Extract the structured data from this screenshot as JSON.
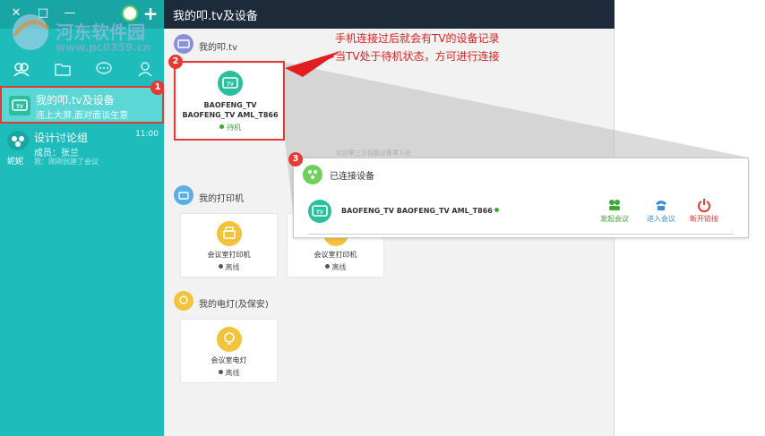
{
  "sidebar": {
    "items": [
      {
        "title": "我的叩.tv及设备",
        "subtitle": "连上大屏,面对面谈生意"
      },
      {
        "title": "设计讨论组",
        "subtitle": "成员：张兰",
        "extra": "我：刚刚创建了会议",
        "time": "11:00",
        "owner": "妮妮"
      }
    ],
    "badge": "1"
  },
  "main": {
    "title": "我的叩.tv及设备",
    "sections": {
      "tv": {
        "label": "我的叩.tv"
      },
      "printer": {
        "label": "我的打印机"
      },
      "light": {
        "label": "我的电灯(及保安)"
      }
    },
    "tv_card": {
      "name_line1": "BAOFENG_TV",
      "name_line2": "BAOFENG_TV AML_T866",
      "status": "待机"
    },
    "printer_cards": [
      {
        "name": "会议室打印机",
        "status": "离线"
      },
      {
        "name": "会议室打印机",
        "status": "离线"
      }
    ],
    "light_card": {
      "name": "会议室电灯",
      "status": "离线"
    },
    "welcome": "欢迎第三方智能设备乘入驻",
    "badge": "2"
  },
  "annotation": {
    "line1": "手机连接过后就会有TV的设备记录",
    "line2": "当TV处于待机状态，方可进行连接"
  },
  "popup": {
    "title": "已连接设备",
    "device": "BAOFENG_TV BAOFENG_TV AML_T866",
    "badge": "3",
    "actions": {
      "start": "发起会议",
      "join": "进入会议",
      "disconnect": "断开链接"
    }
  },
  "watermark": {
    "line1": "河东软件园",
    "line2": "www.pc0359.cn"
  },
  "colors": {
    "sidebar": "#1fbcbc",
    "header": "#1d2a3a",
    "accent_red": "#e53935",
    "tv_green": "#2bbfa0",
    "start_green": "#3aaa35",
    "join_blue": "#3b8fd9",
    "disconnect_red": "#e53935"
  }
}
